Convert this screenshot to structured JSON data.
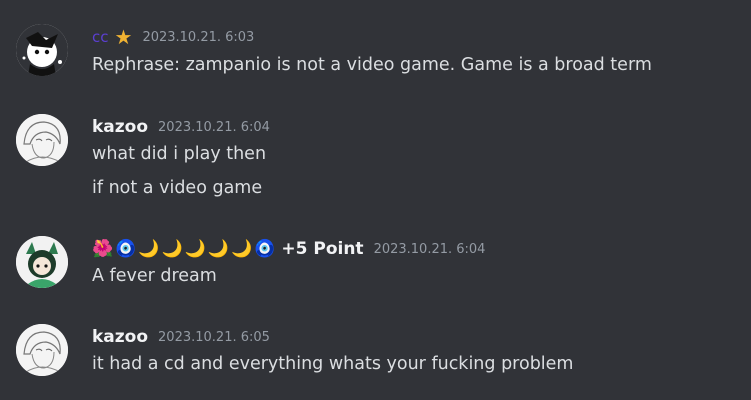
{
  "messages": [
    {
      "author": "cc",
      "badge_icon": "star-icon",
      "timestamp": "2023.10.21. 6:03",
      "lines": [
        "Rephrase: zampanio is not a video game. Game is a broad term"
      ]
    },
    {
      "author": "kazoo",
      "timestamp": "2023.10.21. 6:04",
      "lines": [
        "what did i play then",
        "if not a video game"
      ]
    },
    {
      "author": "+5 Point",
      "emoji_prefix": [
        "🌺",
        "🧿",
        "🌙",
        "🌙",
        "🌙",
        "🌙",
        "🌙",
        "🧿"
      ],
      "timestamp": "2023.10.21. 6:04",
      "lines": [
        "A fever dream"
      ]
    },
    {
      "author": "kazoo",
      "timestamp": "2023.10.21. 6:05",
      "lines": [
        "it had a cd and everything whats your fucking problem"
      ]
    }
  ],
  "colors": {
    "background": "#313338",
    "text": "#dbdee1",
    "timestamp": "#949ba4",
    "cc_name": "#5b3fd1",
    "star": "#f0b232"
  }
}
